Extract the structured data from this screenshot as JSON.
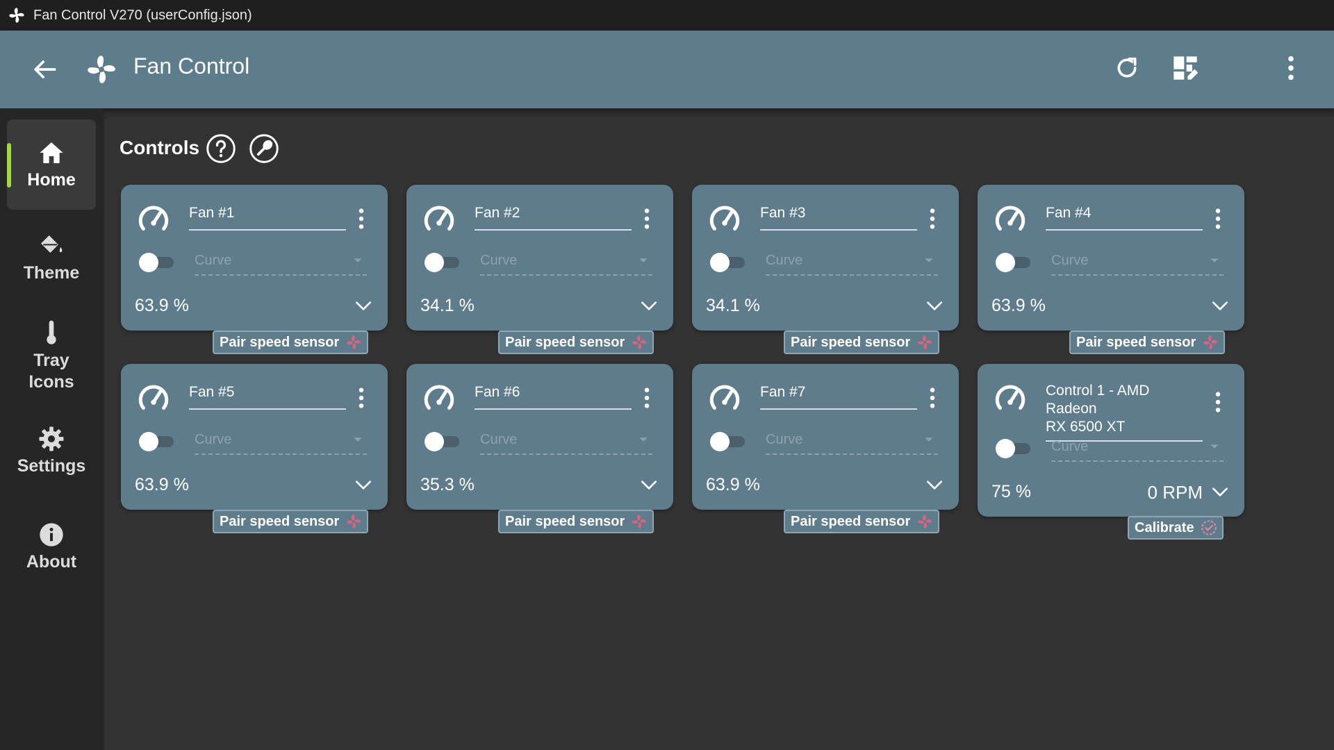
{
  "window": {
    "title": "Fan Control V270 (userConfig.json)"
  },
  "appbar": {
    "title": "Fan Control"
  },
  "sidebar": {
    "items": [
      {
        "label": "Home",
        "icon": "home-icon"
      },
      {
        "label": "Theme",
        "icon": "paint-bucket-icon"
      },
      {
        "label": "Tray\nIcons",
        "label_line1": "Tray",
        "label_line2": "Icons",
        "icon": "thermometer-icon"
      },
      {
        "label": "Settings",
        "icon": "gear-icon"
      },
      {
        "label": "About",
        "icon": "info-icon"
      }
    ],
    "accent_color": "#a4d83c"
  },
  "controls": {
    "title": "Controls",
    "cards": [
      {
        "name": "Fan #1",
        "mode": "Curve",
        "percent": "63.9 %",
        "enabled": false,
        "action": "Pair speed sensor"
      },
      {
        "name": "Fan #2",
        "mode": "Curve",
        "percent": "34.1 %",
        "enabled": false,
        "action": "Pair speed sensor"
      },
      {
        "name": "Fan #3",
        "mode": "Curve",
        "percent": "34.1 %",
        "enabled": false,
        "action": "Pair speed sensor"
      },
      {
        "name": "Fan #4",
        "mode": "Curve",
        "percent": "63.9 %",
        "enabled": false,
        "action": "Pair speed sensor"
      },
      {
        "name": "Fan #5",
        "mode": "Curve",
        "percent": "63.9 %",
        "enabled": false,
        "action": "Pair speed sensor"
      },
      {
        "name": "Fan #6",
        "mode": "Curve",
        "percent": "35.3 %",
        "enabled": false,
        "action": "Pair speed sensor"
      },
      {
        "name": "Fan #7",
        "mode": "Curve",
        "percent": "63.9 %",
        "enabled": false,
        "action": "Pair speed sensor"
      },
      {
        "name_line1": "Control 1 - AMD Radeon",
        "name_line2": "RX 6500 XT",
        "mode": "Curve",
        "percent": "75 %",
        "rpm": "0 RPM",
        "enabled": false,
        "action": "Calibrate"
      }
    ]
  },
  "colors": {
    "card": "#5e7c8c",
    "appbar": "#5d7d8d",
    "fan_icon_accent": "#e0607e",
    "calibrate_icon": "#e88aa0"
  }
}
